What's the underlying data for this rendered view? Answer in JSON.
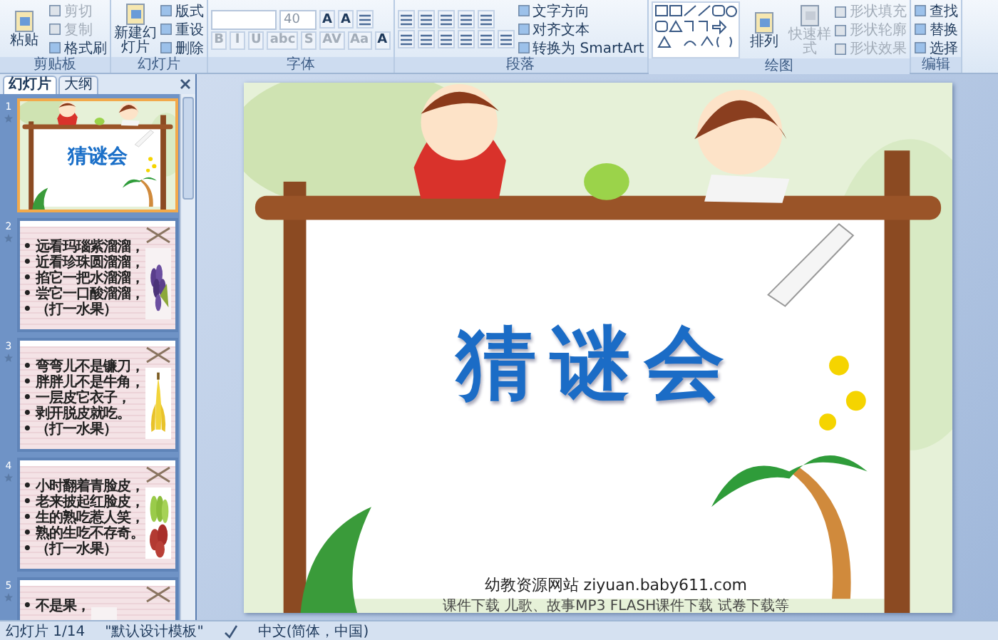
{
  "ribbon": {
    "groups": [
      {
        "label": "剪贴板",
        "columns": [
          [
            [
              {
                "kind": "large",
                "label": "粘贴",
                "disabled": false
              }
            ]
          ],
          [
            [
              {
                "kind": "small",
                "label": "剪切",
                "disabled": true
              }
            ],
            [
              {
                "kind": "small",
                "label": "复制",
                "disabled": true
              }
            ],
            [
              {
                "kind": "small",
                "label": "格式刷",
                "disabled": false
              }
            ]
          ]
        ]
      },
      {
        "label": "幻灯片",
        "columns": [
          [
            [
              {
                "kind": "large",
                "label": "新建幻灯片",
                "disabled": false
              }
            ]
          ],
          [
            [
              {
                "kind": "small",
                "label": "版式",
                "disabled": false
              }
            ],
            [
              {
                "kind": "small",
                "label": "重设",
                "disabled": false
              }
            ],
            [
              {
                "kind": "small",
                "label": "删除",
                "disabled": false
              }
            ]
          ]
        ]
      },
      {
        "label": "字体",
        "columns": [
          [
            [
              {
                "kind": "field"
              },
              {
                "kind": "field",
                "value": "40"
              },
              {
                "kind": "glyph",
                "label": "A",
                "disabled": false
              },
              {
                "kind": "glyph",
                "label": "A",
                "disabled": false
              },
              {
                "kind": "tool"
              }
            ],
            [
              {
                "kind": "glyph",
                "label": "B",
                "disabled": true
              },
              {
                "kind": "glyph",
                "label": "I",
                "disabled": true
              },
              {
                "kind": "glyph",
                "label": "U",
                "disabled": true
              },
              {
                "kind": "glyph",
                "label": "abc",
                "disabled": true
              },
              {
                "kind": "glyph",
                "label": "S",
                "disabled": true
              },
              {
                "kind": "glyph",
                "label": "AV",
                "disabled": true
              },
              {
                "kind": "glyph",
                "label": "Aa",
                "disabled": true
              },
              {
                "kind": "glyph",
                "label": "A",
                "disabled": false
              }
            ]
          ]
        ]
      },
      {
        "label": "段落",
        "columns": [
          [
            [
              {
                "kind": "tool"
              },
              {
                "kind": "tool"
              },
              {
                "kind": "tool"
              },
              {
                "kind": "tool"
              },
              {
                "kind": "tool"
              }
            ],
            [
              {
                "kind": "tool"
              },
              {
                "kind": "tool"
              },
              {
                "kind": "tool"
              },
              {
                "kind": "tool"
              },
              {
                "kind": "tool"
              },
              {
                "kind": "tool"
              }
            ]
          ],
          [
            [
              {
                "kind": "small",
                "label": "文字方向",
                "disabled": false
              }
            ],
            [
              {
                "kind": "small",
                "label": "对齐文本",
                "disabled": false
              }
            ],
            [
              {
                "kind": "small",
                "label": "转换为 SmartArt",
                "disabled": false
              }
            ]
          ]
        ]
      },
      {
        "label": "绘图",
        "columns": [
          [
            [
              {
                "kind": "shapes"
              }
            ]
          ],
          [
            [
              {
                "kind": "large",
                "label": "排列",
                "disabled": false
              }
            ]
          ],
          [
            [
              {
                "kind": "large",
                "label": "快速样式",
                "disabled": true
              }
            ]
          ],
          [
            [
              {
                "kind": "small",
                "label": "形状填充",
                "disabled": true
              }
            ],
            [
              {
                "kind": "small",
                "label": "形状轮廓",
                "disabled": true
              }
            ],
            [
              {
                "kind": "small",
                "label": "形状效果",
                "disabled": true
              }
            ]
          ]
        ]
      },
      {
        "label": "编辑",
        "columns": [
          [
            [
              {
                "kind": "small",
                "label": "查找",
                "disabled": false
              }
            ],
            [
              {
                "kind": "small",
                "label": "替换",
                "disabled": false
              }
            ],
            [
              {
                "kind": "small",
                "label": "选择",
                "disabled": false
              }
            ]
          ]
        ]
      }
    ]
  },
  "pane": {
    "tabs": [
      {
        "label": "幻灯片",
        "selected": true
      },
      {
        "label": "大纲",
        "selected": false
      }
    ],
    "slides": [
      {
        "number": "1",
        "selected": true,
        "kind": "title",
        "title": "猜谜会"
      },
      {
        "number": "2",
        "selected": false,
        "kind": "riddle",
        "lines": [
          "• 远看玛瑙紫溜溜，",
          "• 近看珍珠圆溜溜，",
          "• 掐它一把水溜溜，",
          "• 尝它一口酸溜溜，",
          "• （打一水果）"
        ]
      },
      {
        "number": "3",
        "selected": false,
        "kind": "riddle",
        "lines": [
          "• 弯弯儿不是镰刀，",
          "• 胖胖儿不是牛角，",
          "• 一层皮它衣子，",
          "• 剥开脱皮就吃。",
          "• （打一水果）"
        ]
      },
      {
        "number": "4",
        "selected": false,
        "kind": "riddle",
        "lines": [
          "• 小时翻着青脸皮，",
          "• 老来披起红脸皮，",
          "• 生的熟吃惹人笑，",
          "• 熟的生吃不存奇。",
          "• （打一水果）"
        ]
      },
      {
        "number": "5",
        "selected": false,
        "kind": "riddle",
        "lines": [
          "• 不是果，"
        ]
      }
    ]
  },
  "slide": {
    "title": "猜谜会",
    "footer": "幼教资源网站 ziyuan.baby611.com",
    "footer_sub": "课件下载  儿歌、故事MP3  FLASH课件下载  试卷下载等"
  },
  "status_bar": {
    "slide": "幻灯片 1/14",
    "theme": "\"默认设计模板\"",
    "language": "中文(简体，中国)"
  }
}
